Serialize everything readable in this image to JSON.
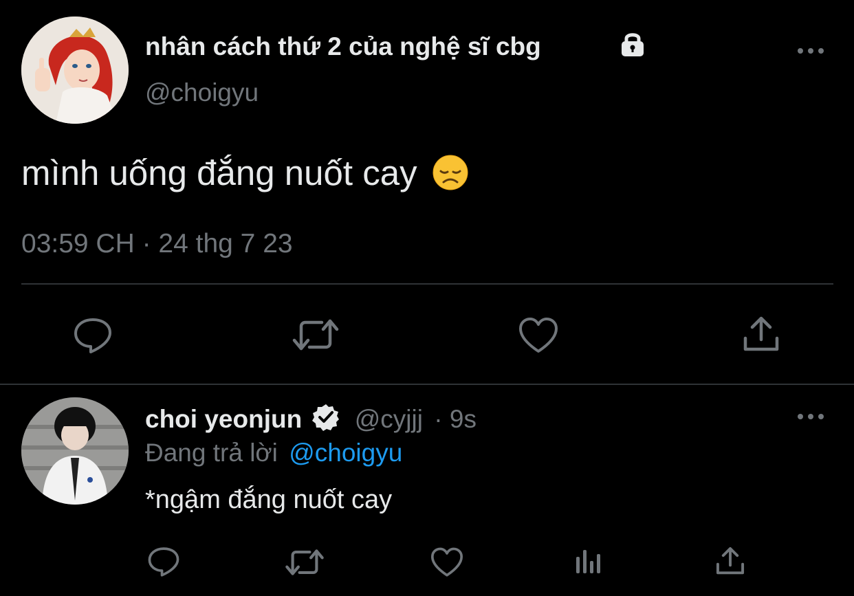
{
  "main_tweet": {
    "display_name": "nhân cách thứ 2 của nghệ sĩ cbg",
    "handle": "@choigyu",
    "text": "mình uống đắng nuốt cay",
    "emoji": "😞",
    "timestamp": "03:59 CH · 24 thg 7 23",
    "protected_icon": "lock-icon",
    "more_icon": "more-icon"
  },
  "actions": {
    "reply_icon": "reply-icon",
    "retweet_icon": "retweet-icon",
    "like_icon": "heart-icon",
    "share_icon": "share-icon",
    "analytics_icon": "analytics-icon"
  },
  "reply": {
    "display_name": "choi yeonjun",
    "handle": "@cyjjj",
    "time": "· 9s",
    "replying_prefix": "Đang trả lời",
    "replying_to": "@choigyu",
    "text": "*ngậm đắng nuốt cay",
    "verified_icon": "verified-badge-icon"
  },
  "colors": {
    "background": "#000000",
    "text": "#e7e9ea",
    "muted": "#71767b",
    "link": "#1d9bf0",
    "divider": "#2f3336"
  }
}
